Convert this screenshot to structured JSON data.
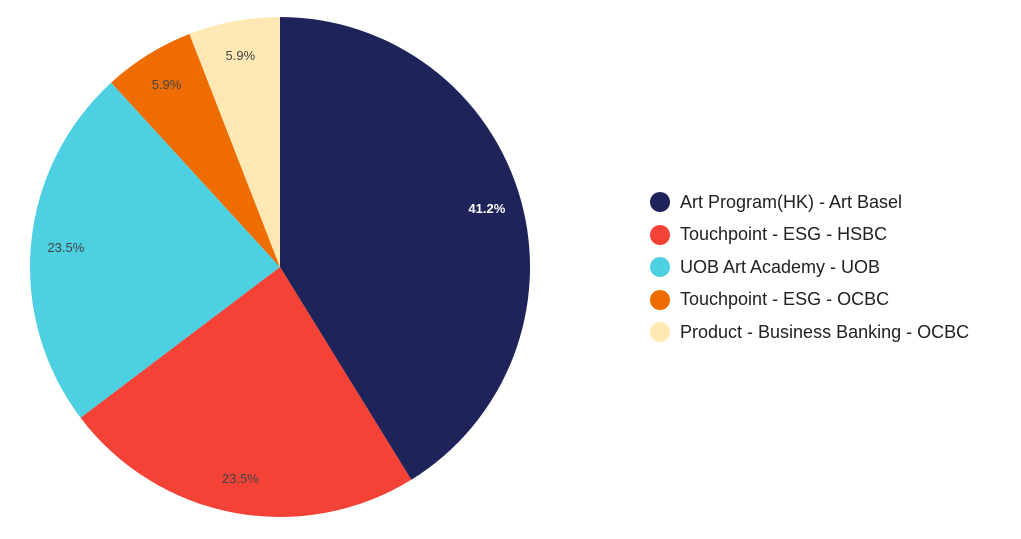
{
  "chart_data": {
    "type": "pie",
    "title": "",
    "legend_position": "right",
    "slices": [
      {
        "label": "Art Program(HK) - Art Basel",
        "value": 41.2,
        "value_label": "41.2%",
        "color": "#1e2359",
        "label_color": "#ffffff"
      },
      {
        "label": "Touchpoint - ESG - HSBC",
        "value": 23.5,
        "value_label": "23.5%",
        "color": "#f44336",
        "label_color": "#444444"
      },
      {
        "label": "UOB Art Academy - UOB",
        "value": 23.5,
        "value_label": "23.5%",
        "color": "#4dd0e1",
        "label_color": "#444444"
      },
      {
        "label": "Touchpoint - ESG - OCBC",
        "value": 5.9,
        "value_label": "5.9%",
        "color": "#ef6c00",
        "label_color": "#444444"
      },
      {
        "label": "Product - Business Banking - OCBC",
        "value": 5.9,
        "value_label": "5.9%",
        "color": "#ffe8b3",
        "label_color": "#444444"
      }
    ]
  }
}
